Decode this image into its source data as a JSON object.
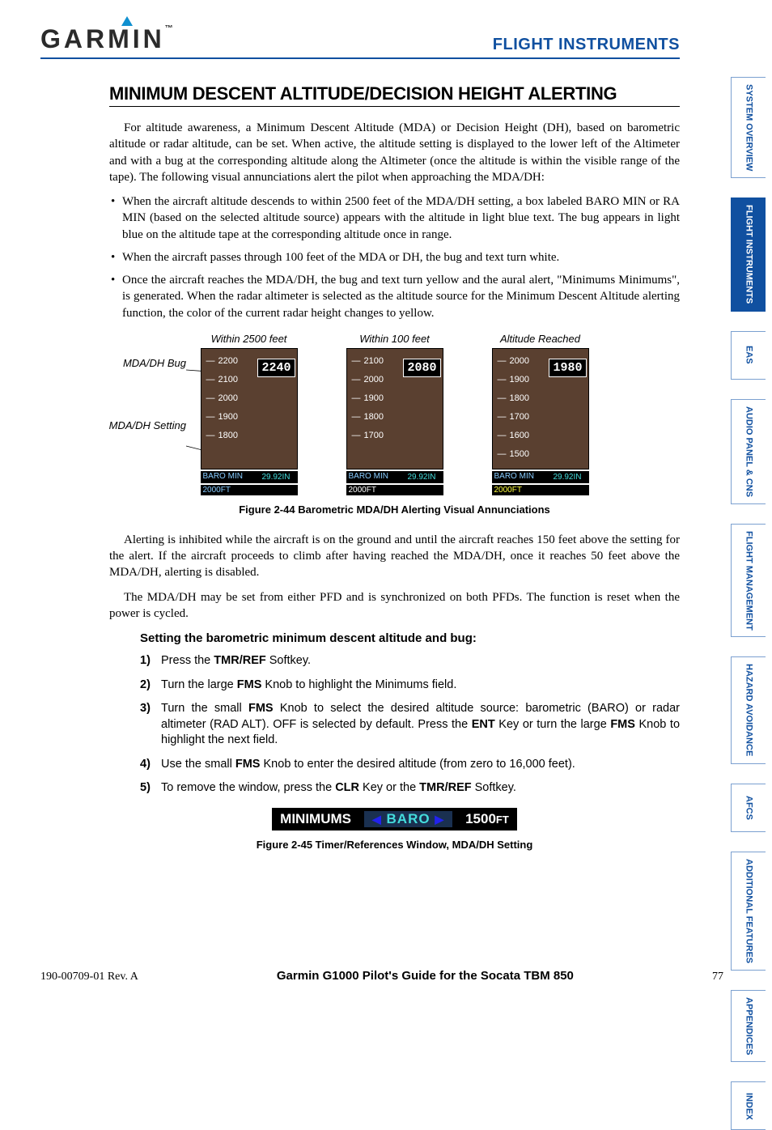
{
  "header": {
    "logo_text": "GARMIN",
    "section": "FLIGHT INSTRUMENTS"
  },
  "title": "MINIMUM DESCENT ALTITUDE/DECISION HEIGHT ALERTING",
  "para1": "For altitude awareness, a Minimum Descent Altitude (MDA) or Decision Height (DH), based on barometric altitude or radar altitude, can be set.  When active, the altitude setting is displayed to the lower left of the Altimeter and with a bug at the corresponding altitude along the Altimeter (once the altitude is within the visible range of the tape).  The following visual annunciations alert the pilot when approaching the MDA/DH:",
  "bullets": [
    "When the aircraft altitude descends to within 2500 feet of the MDA/DH setting, a box labeled BARO MIN or RA MIN (based on the selected altitude source) appears with the altitude in light blue text.  The bug appears in light blue on the altitude tape at the corresponding altitude once in range.",
    "When the aircraft passes through 100 feet of the MDA or DH, the bug and text turn white.",
    "Once the aircraft reaches the MDA/DH, the bug and text turn yellow and the aural alert, \"Minimums Minimums\", is generated.  When the radar altimeter is selected as the altitude source for the Minimum Descent Altitude alerting function, the color of the current radar height changes to yellow."
  ],
  "fig244": {
    "side_label_1": "MDA/DH Bug",
    "side_label_2": "MDA/DH Setting",
    "cols": [
      {
        "label": "Within 2500 feet",
        "alt": "2240",
        "scale": [
          "2200",
          "2100",
          "2000",
          "1900",
          "1800"
        ],
        "baro_ft": "2000FT",
        "baro_in": "29.92IN",
        "color": "blue"
      },
      {
        "label": "Within 100 feet",
        "alt": "2080",
        "scale": [
          "2100",
          "2000",
          "1900",
          "1800",
          "1700"
        ],
        "baro_ft": "2000FT",
        "baro_in": "29.92IN",
        "color": "white"
      },
      {
        "label": "Altitude Reached",
        "alt": "1980",
        "scale": [
          "2000",
          "1900",
          "1800",
          "1700",
          "1600",
          "1500"
        ],
        "baro_ft": "2000FT",
        "baro_in": "29.92IN",
        "color": "yellow"
      }
    ],
    "caption": "Figure 2-44  Barometric MDA/DH Alerting Visual Annunciations"
  },
  "para2": "Alerting is inhibited while the aircraft is on the ground and until the aircraft reaches 150 feet above the setting for the alert.  If the aircraft proceeds to climb after having reached the MDA/DH, once it reaches 50 feet above the MDA/DH, alerting is disabled.",
  "para3": "The MDA/DH may be set from either PFD and is synchronized on both PFDs.  The function is reset when the power is cycled.",
  "proc_head": "Setting the barometric minimum descent altitude and bug:",
  "steps": [
    "Press the <b>TMR/REF</b> Softkey.",
    "Turn the large <b>FMS</b> Knob to highlight the Minimums field.",
    "Turn the small <b>FMS</b> Knob to select the desired altitude source: barometric (BARO)  or radar altimeter (RAD ALT). OFF is selected by default.  Press the <b>ENT</b> Key or turn the large <b>FMS</b> Knob to highlight the next field.",
    "Use the small <b>FMS</b> Knob to enter the desired altitude (from zero to 16,000 feet).",
    "To remove the window, press the <b>CLR</b> Key or the <b>TMR/REF</b> Softkey."
  ],
  "fig245": {
    "label": "MINIMUMS",
    "mode": "BARO",
    "value": "1500",
    "unit": "FT",
    "caption": "Figure 2-45  Timer/References Window, MDA/DH Setting"
  },
  "footer": {
    "left": "190-00709-01  Rev. A",
    "center": "Garmin G1000 Pilot's Guide for the Socata TBM 850",
    "right": "77"
  },
  "tabs": [
    "SYSTEM OVERVIEW",
    "FLIGHT INSTRUMENTS",
    "EAS",
    "AUDIO PANEL & CNS",
    "FLIGHT MANAGEMENT",
    "HAZARD AVOIDANCE",
    "AFCS",
    "ADDITIONAL FEATURES",
    "APPENDICES",
    "INDEX"
  ]
}
